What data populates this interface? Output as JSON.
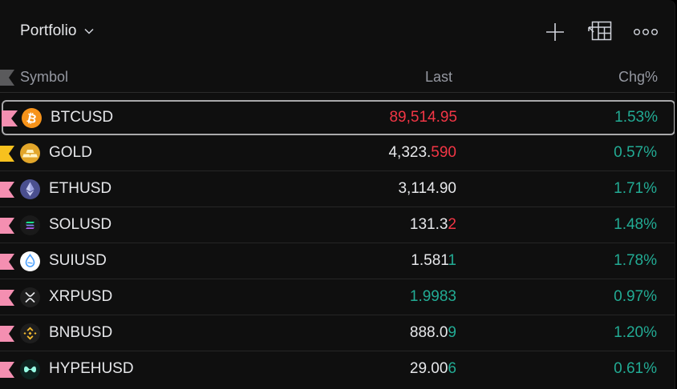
{
  "header": {
    "title": "Portfolio",
    "icons": [
      "chevron-down-icon",
      "plus-icon",
      "table-settings-icon",
      "more-icon"
    ]
  },
  "columns": {
    "symbol": "Symbol",
    "last": "Last",
    "chg": "Chg%"
  },
  "colors": {
    "flag_pink": "#f48fb1",
    "flag_yellow": "#f7c11e",
    "up": "#22ab94",
    "down": "#f23645",
    "background": "#0f0f0f"
  },
  "rows": [
    {
      "symbol": "BTCUSD",
      "last_main": "",
      "last_hl": "89,514.95",
      "last_color": "red",
      "chg": "1.53%",
      "flag": "pink",
      "logo": "bitcoin-icon"
    },
    {
      "symbol": "GOLD",
      "last_main": "4,323.",
      "last_hl": "590",
      "last_color": "red",
      "chg": "0.57%",
      "flag": "yellow",
      "logo": "gold-bars-icon"
    },
    {
      "symbol": "ETHUSD",
      "last_main": "3,114.90",
      "last_hl": "",
      "last_color": "none",
      "chg": "1.71%",
      "flag": "pink",
      "logo": "ethereum-icon"
    },
    {
      "symbol": "SOLUSD",
      "last_main": "131.3",
      "last_hl": "2",
      "last_color": "red",
      "chg": "1.48%",
      "flag": "pink",
      "logo": "solana-icon"
    },
    {
      "symbol": "SUIUSD",
      "last_main": "1.581",
      "last_hl": "1",
      "last_color": "green",
      "chg": "1.78%",
      "flag": "pink",
      "logo": "sui-icon"
    },
    {
      "symbol": "XRPUSD",
      "last_main": "",
      "last_hl": "1.9983",
      "last_color": "green",
      "chg": "0.97%",
      "flag": "pink",
      "logo": "xrp-icon"
    },
    {
      "symbol": "BNBUSD",
      "last_main": "888.0",
      "last_hl": "9",
      "last_color": "green",
      "chg": "1.20%",
      "flag": "pink",
      "logo": "bnb-icon"
    },
    {
      "symbol": "HYPEHUSD",
      "last_main": "29.00",
      "last_hl": "6",
      "last_color": "green",
      "chg": "0.61%",
      "flag": "pink",
      "logo": "hyperliquid-icon"
    }
  ]
}
